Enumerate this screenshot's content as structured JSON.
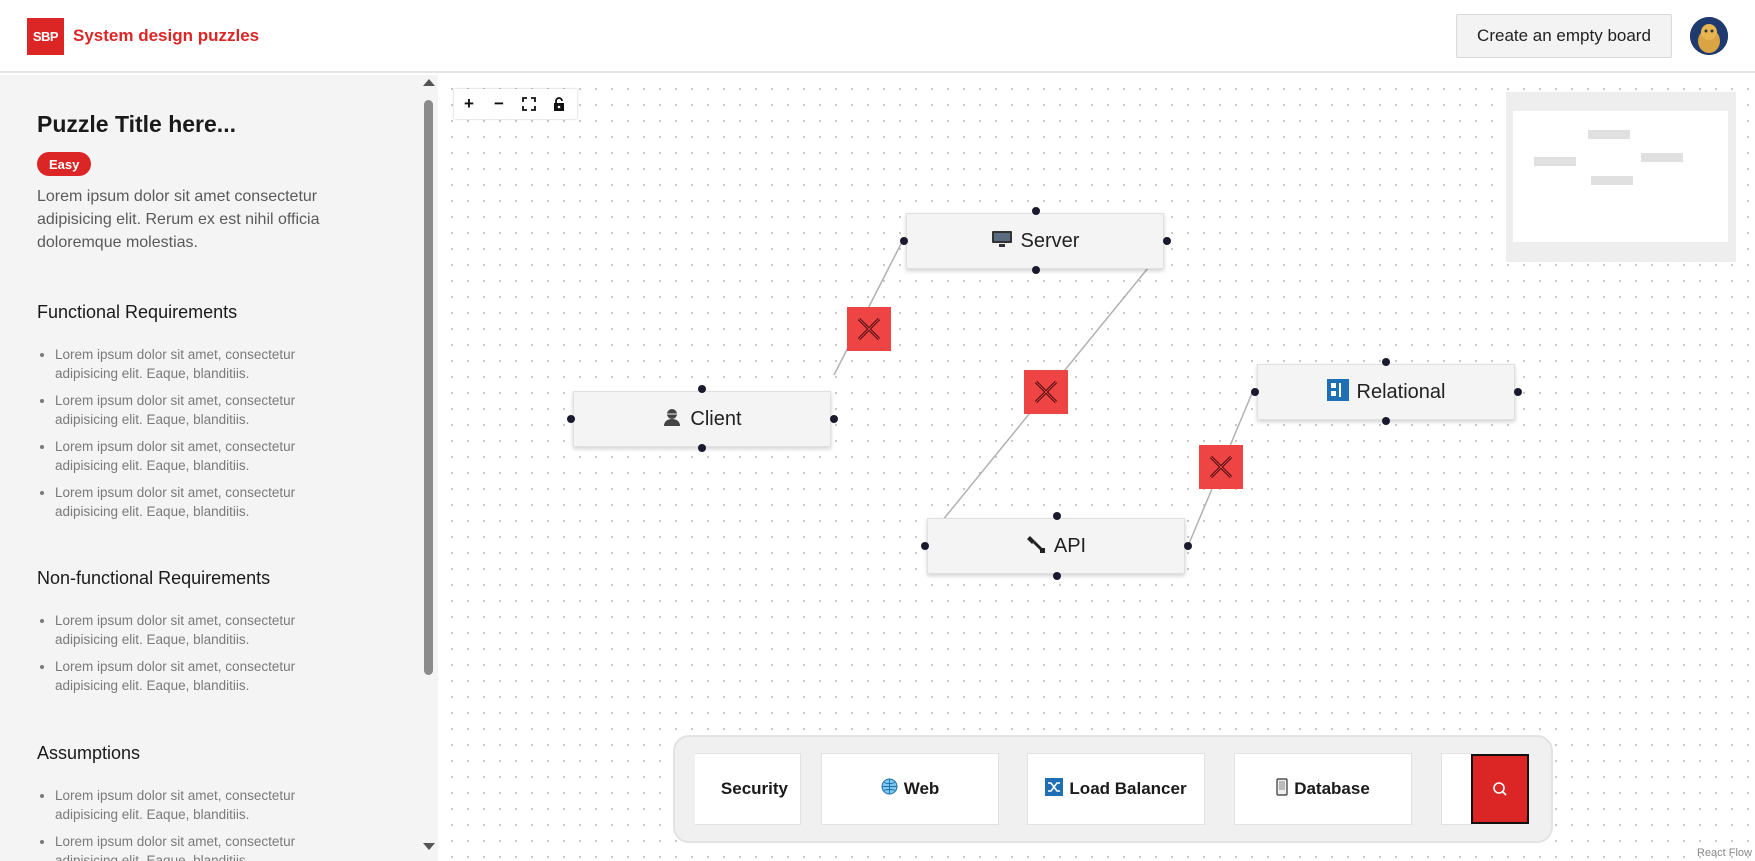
{
  "header": {
    "logo_text": "SBP",
    "brand": "System design puzzles",
    "create_button": "Create an empty board",
    "avatar_icon": "user-avatar-icon"
  },
  "sidebar": {
    "title": "Puzzle Title here...",
    "difficulty": "Easy",
    "description": "Lorem ipsum dolor sit amet consectetur adipisicing elit. Rerum ex est nihil officia doloremque molestias.",
    "sections": [
      {
        "title": "Functional Requirements",
        "items": [
          "Lorem ipsum dolor sit amet, consectetur adipisicing elit. Eaque, blanditiis.",
          "Lorem ipsum dolor sit amet, consectetur adipisicing elit. Eaque, blanditiis.",
          "Lorem ipsum dolor sit amet, consectetur adipisicing elit. Eaque, blanditiis.",
          "Lorem ipsum dolor sit amet, consectetur adipisicing elit. Eaque, blanditiis."
        ]
      },
      {
        "title": "Non-functional Requirements",
        "items": [
          "Lorem ipsum dolor sit amet, consectetur adipisicing elit. Eaque, blanditiis.",
          "Lorem ipsum dolor sit amet, consectetur adipisicing elit. Eaque, blanditiis."
        ]
      },
      {
        "title": "Assumptions",
        "items": [
          "Lorem ipsum dolor sit amet, consectetur adipisicing elit. Eaque, blanditiis.",
          "Lorem ipsum dolor sit amet, consectetur adipisicing elit. Eaque, blanditiis."
        ]
      }
    ]
  },
  "canvas": {
    "controls": {
      "zoom_in": "+",
      "zoom_out": "−",
      "fit_view": "⛶",
      "lock": "🔒"
    },
    "nodes": {
      "server": {
        "label": "Server",
        "icon": "🖥"
      },
      "client": {
        "label": "Client",
        "icon": "👤"
      },
      "relational": {
        "label": "Relational",
        "icon": "▦"
      },
      "api": {
        "label": "API",
        "icon": "🔌"
      }
    },
    "palette": [
      {
        "label": "Security",
        "icon": ""
      },
      {
        "label": "Web",
        "icon": "🌐"
      },
      {
        "label": "Load Balancer",
        "icon": "⤨"
      },
      {
        "label": "Database",
        "icon": "▯"
      }
    ],
    "attribution": "React Flow"
  },
  "colors": {
    "accent": "#dc2626",
    "edge_delete": "#ef4444"
  }
}
